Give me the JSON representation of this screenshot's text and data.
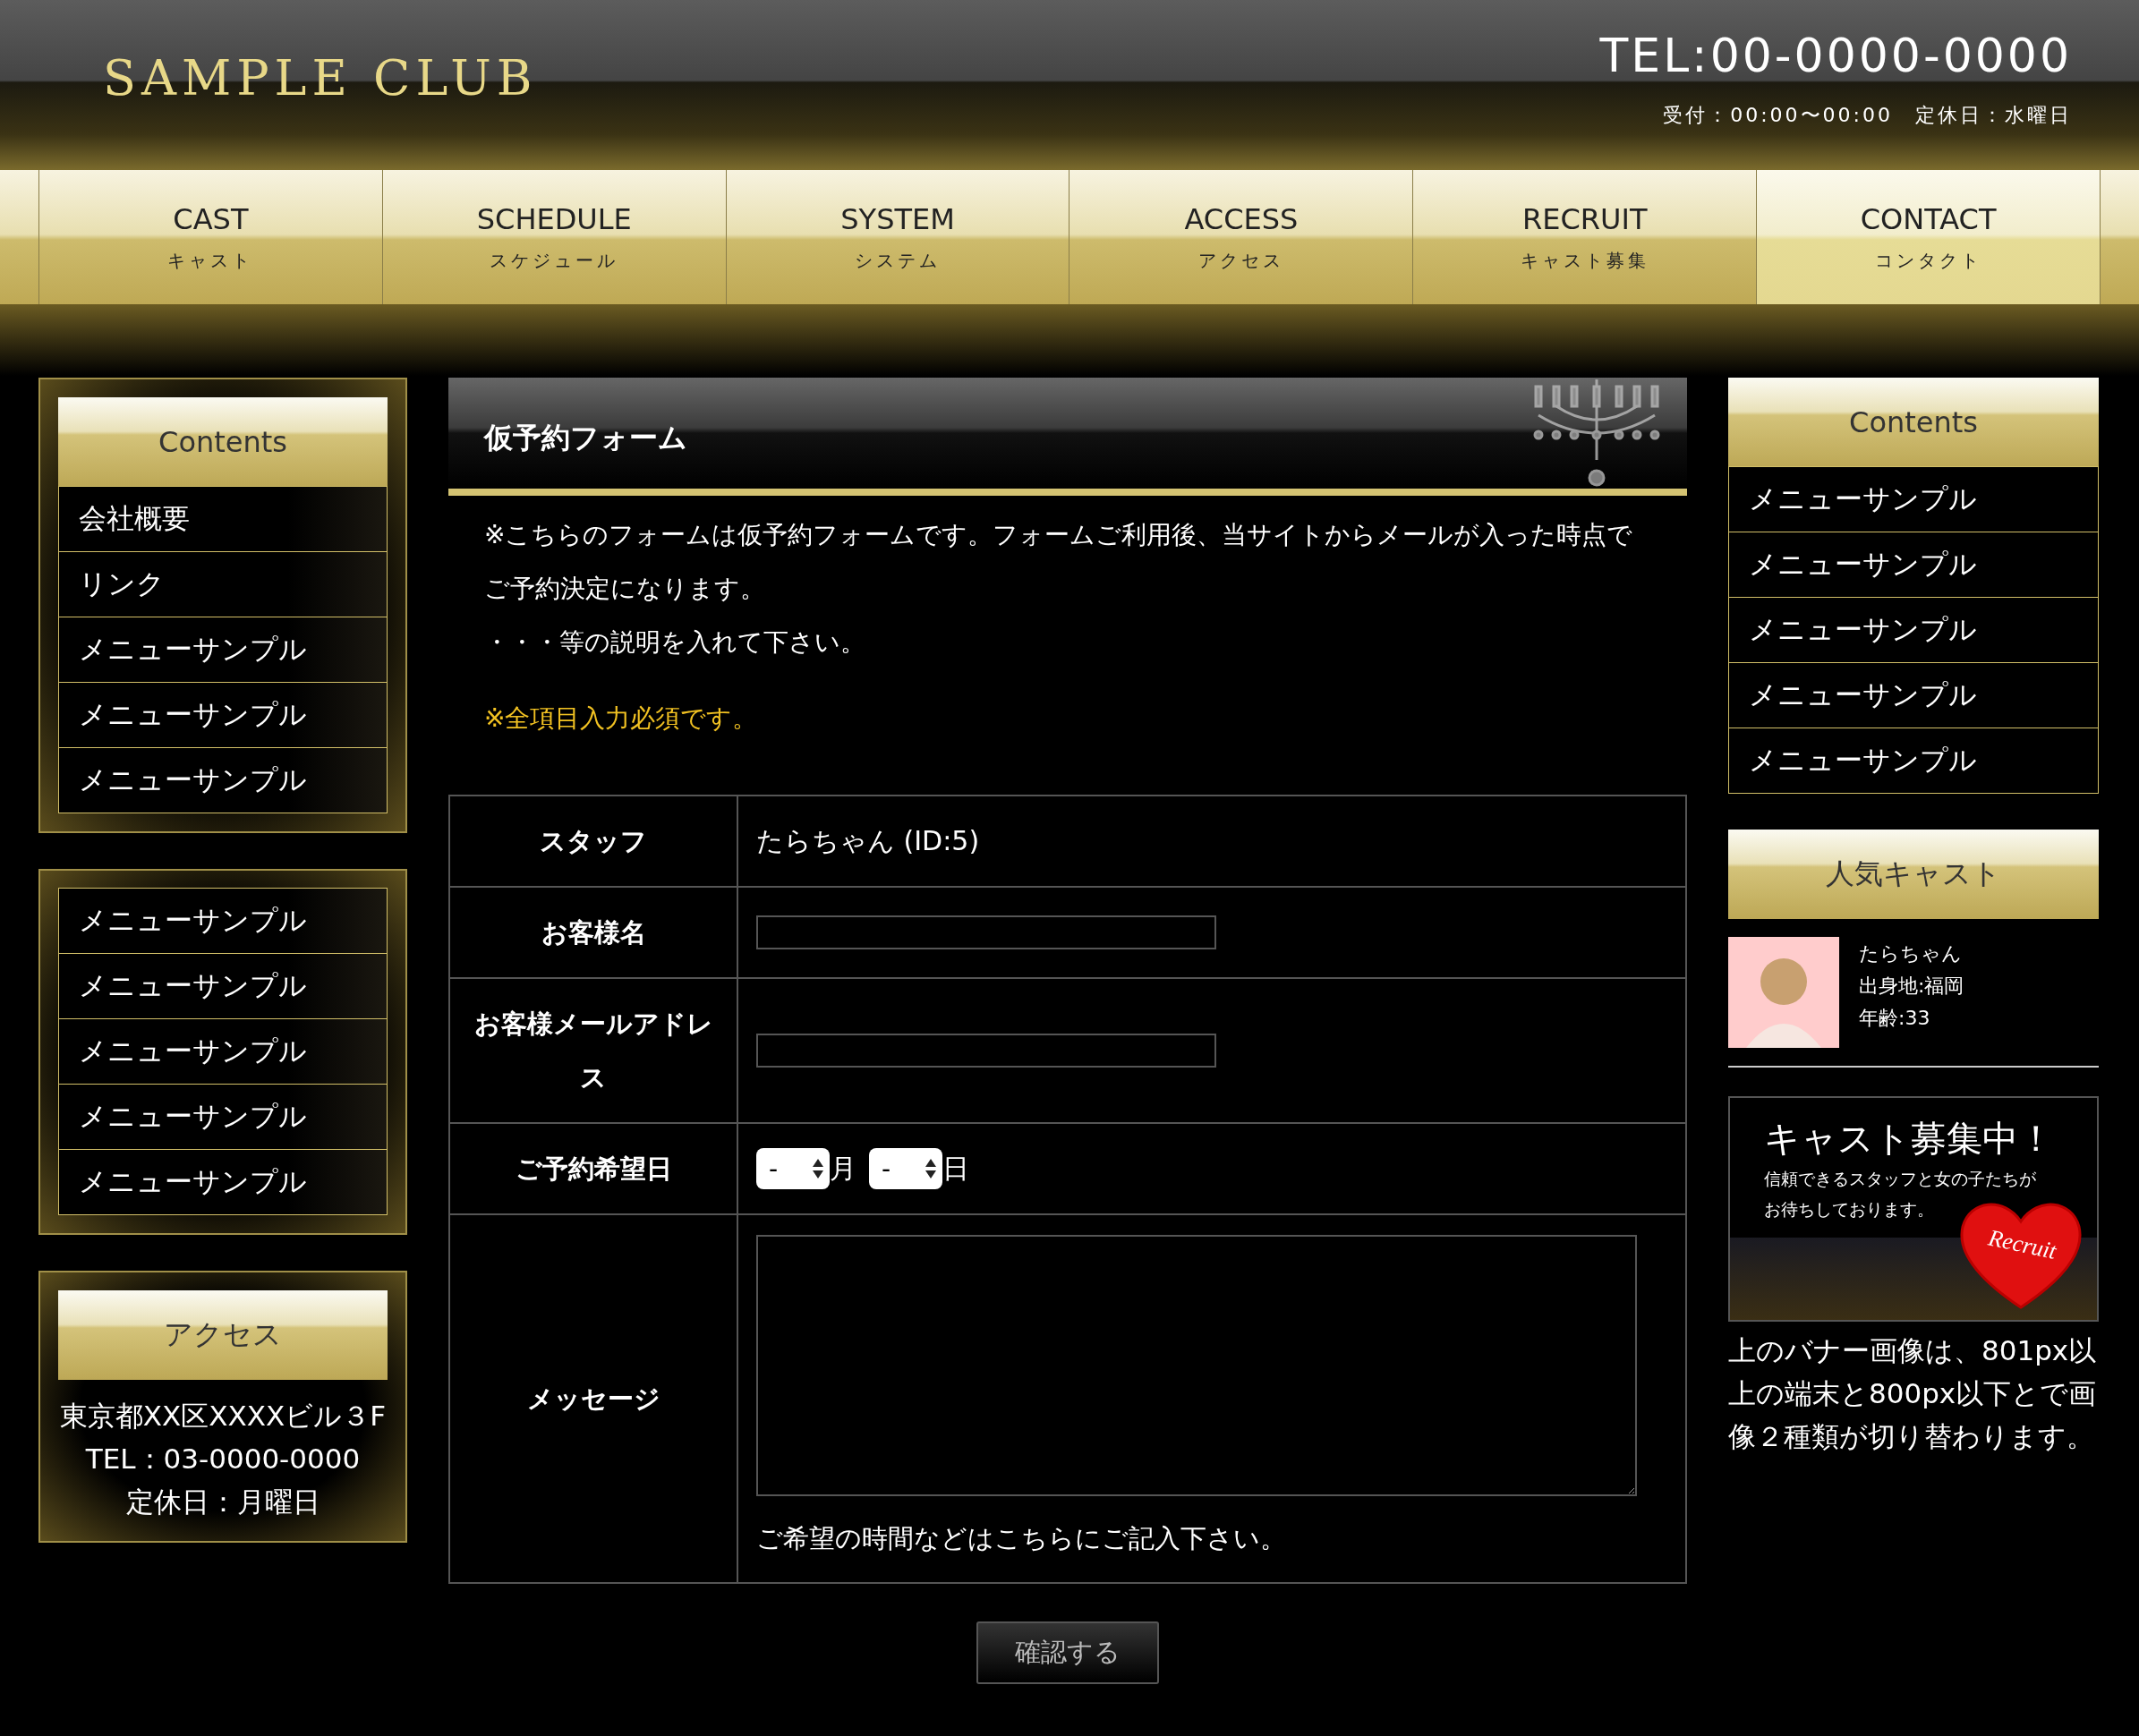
{
  "header": {
    "logo": "SAMPLE CLUB",
    "tel": "TEL:00-0000-0000",
    "hours": "受付：00:00〜00:00　定休日：水曜日"
  },
  "nav": [
    {
      "label": "CAST",
      "sub": "キャスト",
      "selected": false
    },
    {
      "label": "SCHEDULE",
      "sub": "スケジュール",
      "selected": false
    },
    {
      "label": "SYSTEM",
      "sub": "システム",
      "selected": false
    },
    {
      "label": "ACCESS",
      "sub": "アクセス",
      "selected": false
    },
    {
      "label": "RECRUIT",
      "sub": "キャスト募集",
      "selected": false
    },
    {
      "label": "CONTACT",
      "sub": "コンタクト",
      "selected": true
    }
  ],
  "left_sidebar": {
    "contents": {
      "title": "Contents",
      "items": [
        "会社概要",
        "リンク",
        "メニューサンプル",
        "メニューサンプル",
        "メニューサンプル"
      ]
    },
    "menu": {
      "items": [
        "メニューサンプル",
        "メニューサンプル",
        "メニューサンプル",
        "メニューサンプル",
        "メニューサンプル"
      ]
    },
    "access": {
      "title": "アクセス",
      "lines": [
        "東京都XX区XXXXビル３F",
        "TEL：03-0000-0000",
        "定休日：月曜日"
      ]
    }
  },
  "form": {
    "title": "仮予約フォーム",
    "intro": [
      "※こちらのフォームは仮予約フォームです。フォームご利用後、当サイトからメールが入った時点でご予約決定になります。",
      "・・・等の説明を入れて下さい。"
    ],
    "required_note": "※全項目入力必須です。",
    "rows": [
      {
        "label": "スタッフ",
        "kind": "text",
        "value": "たらちゃん (ID:5)"
      },
      {
        "label": "お客様名",
        "kind": "input"
      },
      {
        "label": "お客様メールアドレス",
        "kind": "input"
      },
      {
        "label": "ご予約希望日",
        "kind": "date",
        "selects": [
          {
            "value": "-",
            "unit": "月"
          },
          {
            "value": "-",
            "unit": "日"
          }
        ]
      },
      {
        "label": "メッセージ",
        "kind": "textarea",
        "hint": "ご希望の時間などはこちらにご記入下さい。"
      }
    ],
    "submit": "確認する"
  },
  "right_sidebar": {
    "contents": {
      "title": "Contents",
      "items": [
        "メニューサンプル",
        "メニューサンプル",
        "メニューサンプル",
        "メニューサンプル",
        "メニューサンプル"
      ]
    },
    "popular": {
      "title": "人気キャスト",
      "cast": {
        "name": "たらちゃん",
        "origin": "出身地:福岡",
        "age": "年齢:33"
      }
    },
    "banner": {
      "headline": "キャスト募集中！",
      "lines": [
        "信頼できるスタッフと女の子たちが",
        "お待ちしております。"
      ],
      "badge": "Recruit"
    },
    "note": "上のバナー画像は、801px以上の端末と800px以下とで画像２種類が切り替わります。"
  }
}
